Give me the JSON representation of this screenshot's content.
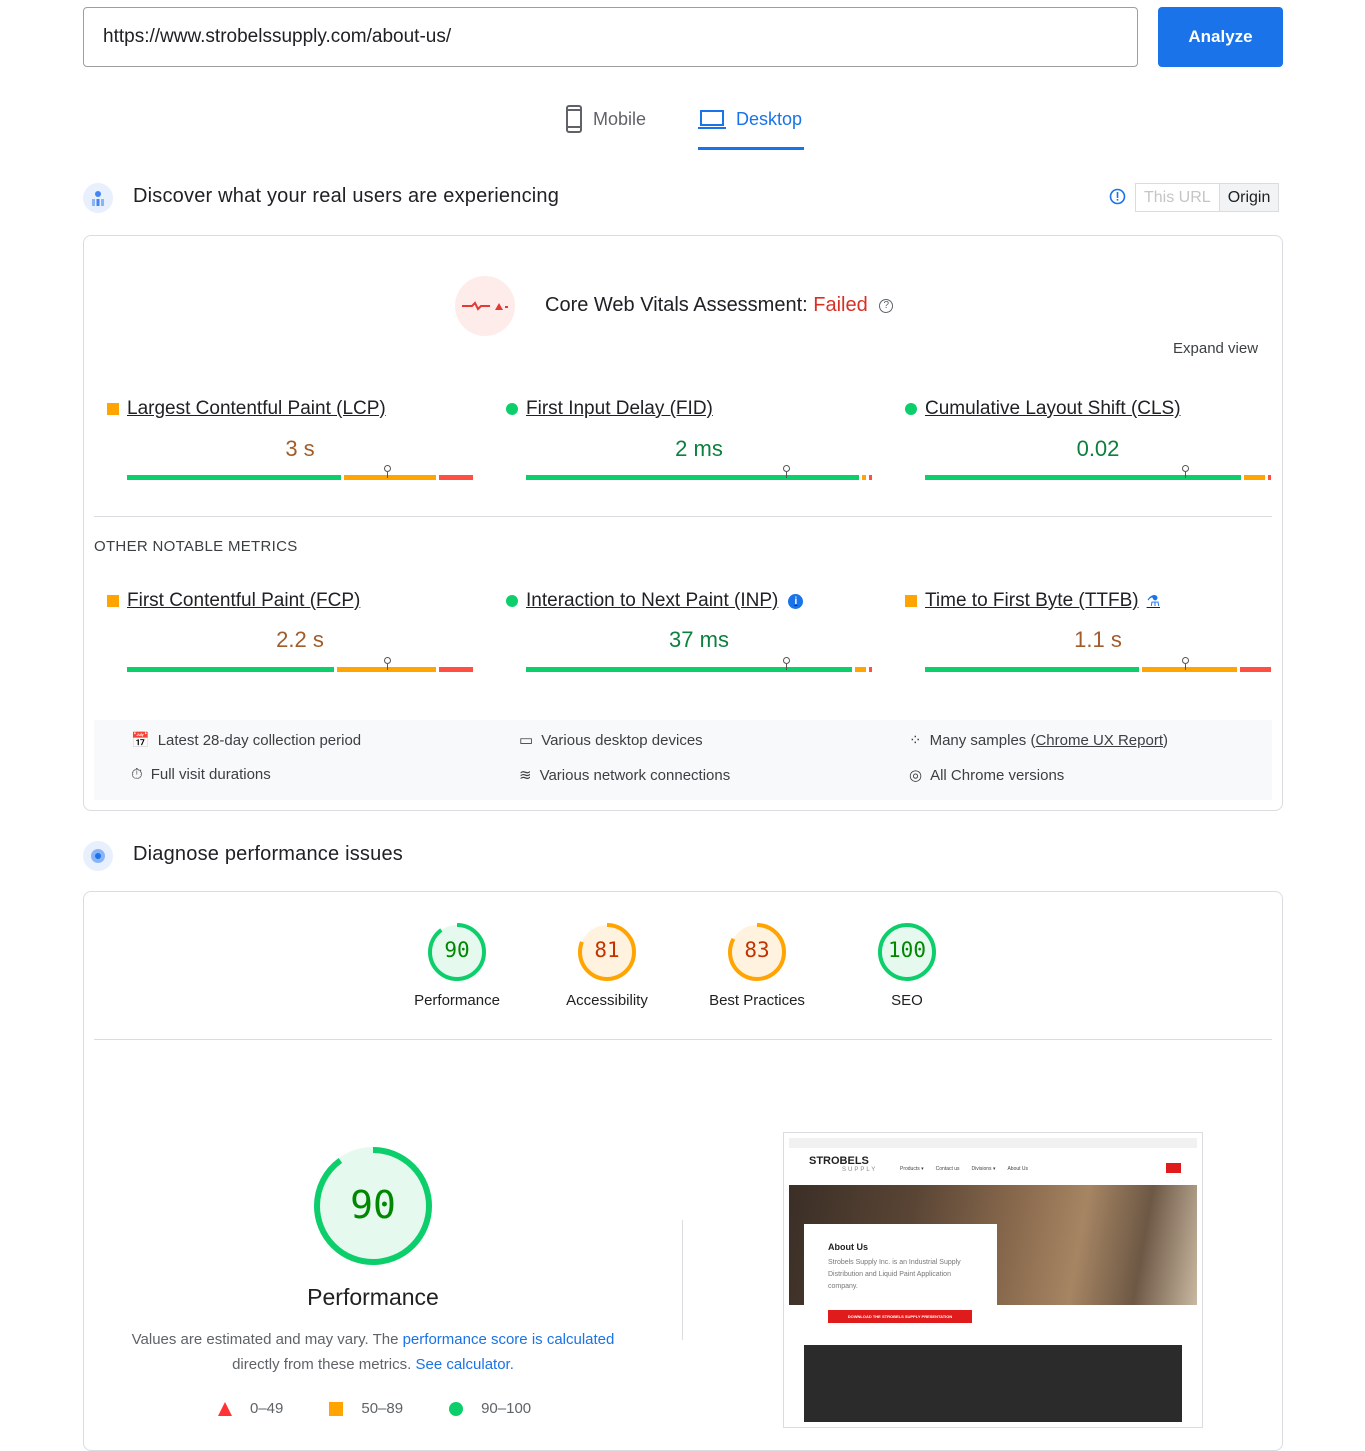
{
  "search": {
    "url": "https://www.strobelssupply.com/about-us/",
    "analyze_label": "Analyze"
  },
  "tabs": [
    {
      "label": "Mobile",
      "icon": "phone-icon",
      "active": false
    },
    {
      "label": "Desktop",
      "icon": "laptop-icon",
      "active": true
    }
  ],
  "field": {
    "title": "Discover what your real users are experiencing",
    "toggle": [
      "This URL",
      "Origin"
    ],
    "assessment_label": "Core Web Vitals Assessment: ",
    "assessment_result": "Failed",
    "expand": "Expand view",
    "other_heading": "OTHER NOTABLE METRICS",
    "colors": {
      "good": "#0cce6b",
      "average": "#ffa400",
      "poor": "#ff4e42",
      "failed": "#d93025"
    },
    "core": [
      {
        "name": "Largest Contentful Paint (LCP)",
        "value": "3 s",
        "status": "average",
        "dist": [
          63,
          27,
          10
        ]
      },
      {
        "name": "First Input Delay (FID)",
        "value": "2 ms",
        "status": "good",
        "dist": [
          98,
          1,
          1
        ]
      },
      {
        "name": "Cumulative Layout Shift (CLS)",
        "value": "0.02",
        "status": "good",
        "dist": [
          93,
          6,
          1
        ]
      }
    ],
    "other": [
      {
        "name": "First Contentful Paint (FCP)",
        "value": "2.2 s",
        "status": "average",
        "dist": [
          61,
          29,
          10
        ]
      },
      {
        "name": "Interaction to Next Paint (INP)",
        "value": "37 ms",
        "status": "good",
        "dist": [
          96,
          3,
          1
        ]
      },
      {
        "name": "Time to First Byte (TTFB)",
        "value": "1.1 s",
        "status": "average",
        "dist": [
          63,
          28,
          9
        ]
      }
    ],
    "info": [
      "Latest 28-day collection period",
      "Various desktop devices",
      "Many samples (",
      "Chrome UX Report",
      ")",
      "Full visit durations",
      "Various network connections",
      "All Chrome versions"
    ]
  },
  "lab": {
    "title": "Diagnose performance issues",
    "scores": [
      {
        "label": "Performance",
        "score": 90
      },
      {
        "label": "Accessibility",
        "score": 81
      },
      {
        "label": "Best Practices",
        "score": 83
      },
      {
        "label": "SEO",
        "score": 100
      }
    ],
    "big_score": 90,
    "big_label": "Performance",
    "note1": "Values are estimated and may vary. The ",
    "note_link1": "performance score is calculated",
    "note2": "directly from these metrics. ",
    "note_link2": "See calculator.",
    "legend": [
      "0–49",
      "50–89",
      "90–100"
    ],
    "screenshot": {
      "logo": "STROBELS",
      "logo_sub": "SUPPLY",
      "nav": [
        "Products ▾",
        "Contact us",
        "Divisions ▾",
        "About Us"
      ],
      "heading": "About Us",
      "body": "Strobels Supply Inc. is an Industrial Supply Distribution and Liquid Paint Application company.",
      "cta": "DOWNLOAD THE STROBELS SUPPLY PRESENTATION"
    }
  }
}
